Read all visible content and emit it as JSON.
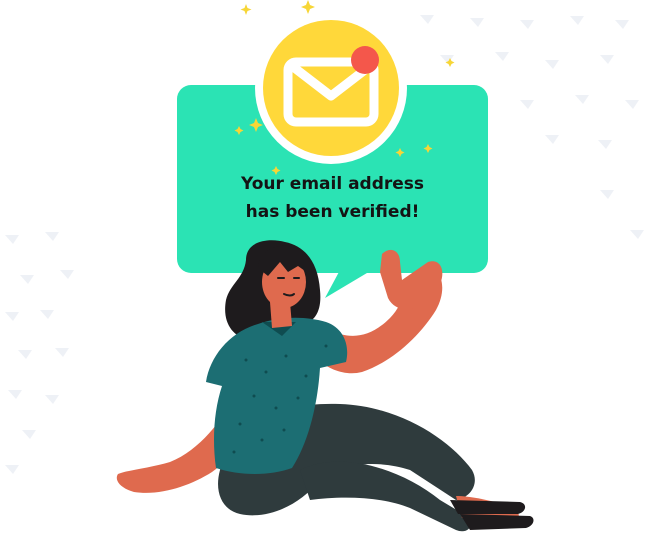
{
  "message": {
    "line1": "Your email address",
    "line2": "has been verified!"
  },
  "colors": {
    "bubble": "#2BE3B4",
    "envelope_circle": "#FFD83A",
    "envelope_frame": "#FFFFFF",
    "notification_dot": "#F4574B",
    "skin": "#DF6A4E",
    "shirt": "#1C6E73",
    "pants": "#2F3B3D",
    "hair": "#1E1B1D",
    "sparkle": "#F7D636",
    "pattern": "#EEF1F6"
  },
  "icons": {
    "envelope": "envelope-icon",
    "notification": "notification-dot-icon",
    "sparkles": "sparkle-icon"
  }
}
